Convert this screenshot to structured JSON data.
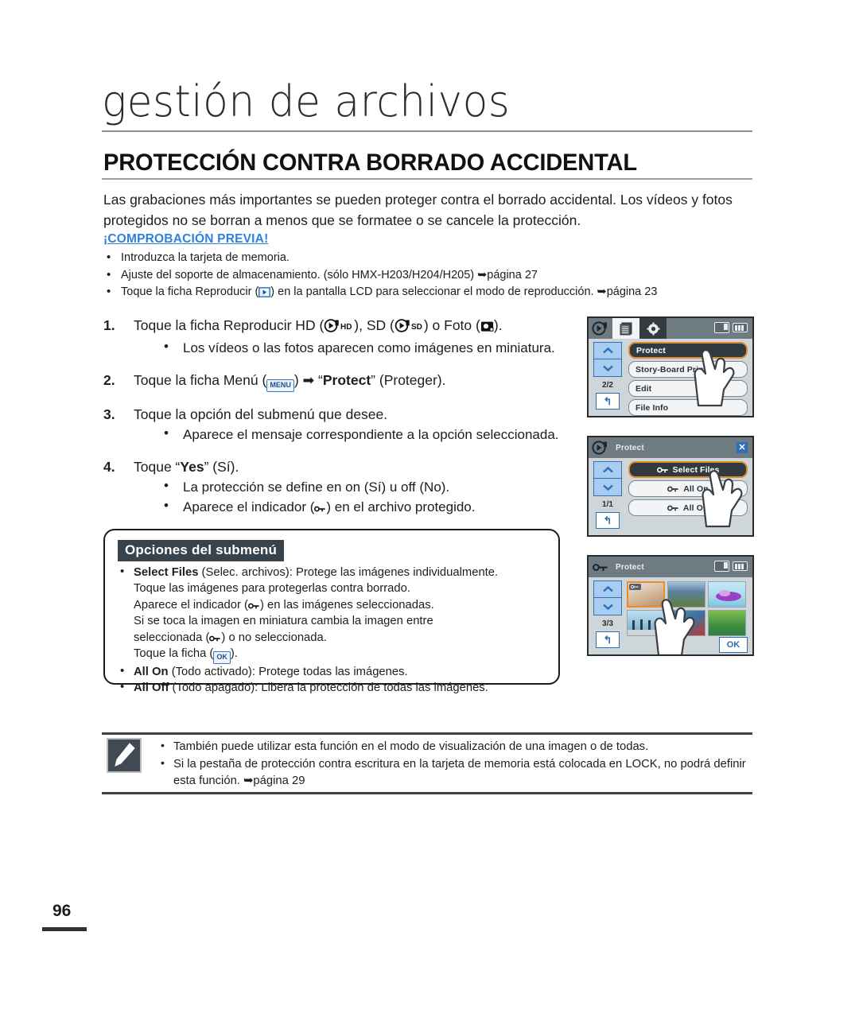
{
  "chapter": {
    "title": "gestión de archivos"
  },
  "section": {
    "title": "PROTECCIÓN CONTRA BORRADO ACCIDENTAL"
  },
  "intro": "Las grabaciones más importantes se pueden proteger contra el borrado accidental. Los vídeos y fotos protegidos no se borran a menos que se formatee o se cancele la protección.",
  "precheck": {
    "heading": "¡COMPROBACIÓN PREVIA!",
    "items": [
      {
        "text": "Introduzca la tarjeta de memoria."
      },
      {
        "text": "Ajuste del soporte de almacenamiento. (sólo HMX-H203/H204/H205) ➥página 27"
      },
      {
        "pre": "Toque la ficha Reproducir (",
        "post": ") en la pantalla LCD para seleccionar el modo de reproducción. ➥página 23"
      }
    ]
  },
  "steps": [
    {
      "num": "1.",
      "pre": "Toque la ficha Reproducir HD (",
      "mid1": "), SD (",
      "mid2": ") o Foto (",
      "post": ").",
      "subs": [
        "Los vídeos o las fotos aparecen como imágenes en miniatura."
      ]
    },
    {
      "num": "2.",
      "pre": "Toque la ficha Menú (",
      "post": ") ➡ “Protect” (Proteger).",
      "bold_label": "Protect",
      "subs": []
    },
    {
      "num": "3.",
      "pre": "Toque la opción del submenú que desee.",
      "subs": [
        "Aparece el mensaje correspondiente a la opción seleccionada."
      ]
    },
    {
      "num": "4.",
      "pre": "Toque “Yes” (Sí).",
      "bold_label": "Yes",
      "subs": [
        "La protección se define en on (Sí) u off (No).",
        "Aparece el indicador (  ) en el archivo protegido."
      ]
    }
  ],
  "submenu": {
    "heading": "Opciones del submenú",
    "select_files_bold": "Select Files",
    "select_files_rest": " (Selec. archivos): Protege las imágenes individualmente.",
    "select_files_lines": [
      "Toque las imágenes para protegerlas contra borrado.",
      "Aparece el indicador (  ) en las imágenes seleccionadas.",
      "Si se toca la imagen en miniatura cambia la imagen entre",
      "seleccionada (  ) o no seleccionada.",
      "Toque la ficha (  )."
    ],
    "ok_label": "OK",
    "all_on_bold": "All On",
    "all_on_rest": " (Todo activado): Protege todas las imágenes.",
    "all_off_bold": "All Off",
    "all_off_rest": " (Todo apagado): Libera la protección de todas las imágenes."
  },
  "notes": [
    "También puede utilizar esta función en el modo de visualización de una imagen o de todas.",
    "Si la pestaña de protección contra escritura en la tarjeta de memoria está colocada en LOCK, no podrá definir esta función. ➥página 29"
  ],
  "page_number": "96",
  "screens": {
    "menu": {
      "page_indicator": "2/2",
      "rows": [
        {
          "label": "Protect",
          "selected": true
        },
        {
          "label": "Story-Board Print",
          "selected": false
        },
        {
          "label": "Edit",
          "selected": false
        },
        {
          "label": "File Info",
          "selected": false
        }
      ]
    },
    "protect": {
      "title": "Protect",
      "page_indicator": "1/1",
      "rows": [
        {
          "label": "Select Files",
          "selected": true
        },
        {
          "label": "All On",
          "selected": false
        },
        {
          "label": "All Off",
          "selected": false
        }
      ]
    },
    "thumbnails": {
      "title": "Protect",
      "page_indicator": "3/3",
      "ok_label": "OK",
      "items": [
        {
          "selected": true,
          "protected": true,
          "c1": "#cfa98c",
          "c2": "#e7e3de"
        },
        {
          "selected": false,
          "protected": false,
          "c1": "#4a6f8f",
          "c2": "#6f8f52"
        },
        {
          "selected": false,
          "protected": false,
          "c1": "#bfe6f2",
          "c2": "#9b3fc4"
        },
        {
          "selected": false,
          "protected": false,
          "c1": "#a8d8ee",
          "c2": "#4a7fa8"
        },
        {
          "selected": false,
          "protected": false,
          "c1": "#3f6f9f",
          "c2": "#c0392b"
        },
        {
          "selected": false,
          "protected": false,
          "c1": "#2f7f3f",
          "c2": "#7fbf4f"
        }
      ]
    }
  },
  "colors": {
    "accent_blue": "#2f7fe0",
    "selection_orange": "#e08a28",
    "header_gray": "#6f7b82",
    "screen_bg": "#cfd6da"
  }
}
